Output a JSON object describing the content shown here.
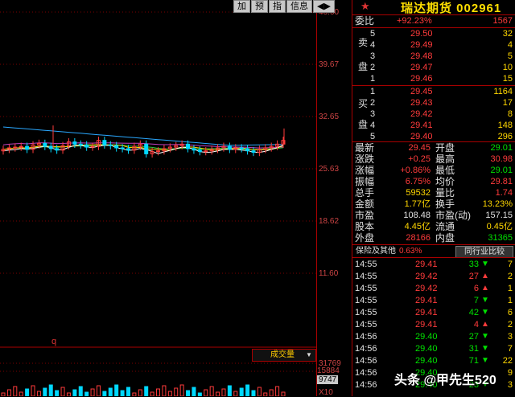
{
  "toolbar": [
    "加",
    "预",
    "指",
    "信息",
    "◀▶"
  ],
  "price_axis": [
    "46.60",
    "39.67",
    "32.65",
    "25.63",
    "18.62",
    "11.60"
  ],
  "volume_axis": [
    "31769",
    "15884",
    "9747",
    "X10"
  ],
  "volume_button": "成交量",
  "volume_button_arrow": "▼",
  "marker_q": "q",
  "chart_data": {
    "type": "candlestick",
    "title": "",
    "ylim": [
      11.6,
      46.6
    ],
    "closes": [
      28.2,
      28.4,
      28.5,
      28.6,
      28.2,
      28.8,
      29.0,
      28.6,
      28.3,
      28.1,
      28.7,
      29.2,
      28.9,
      28.8,
      28.5,
      28.6,
      29.4,
      28.8,
      28.7,
      28.4,
      28.3,
      28.1,
      28.6,
      28.9,
      27.6,
      27.9,
      28.0,
      28.3,
      28.5,
      28.7,
      28.9,
      28.3,
      28.1,
      27.9,
      28.0,
      28.2,
      28.4,
      28.6,
      28.2,
      28.4,
      28.3,
      28.0,
      27.8,
      28.2,
      28.4,
      28.6,
      28.9,
      29.4
    ]
  },
  "panel": {
    "title_star": "★",
    "title": "瑞达期货 002961",
    "weibi_label": "委比",
    "weibi_pct": "+92.23%",
    "weibi_val": "1567",
    "sell_side": [
      "卖",
      "盘"
    ],
    "buy_side": [
      "买",
      "盘"
    ],
    "sell": [
      {
        "n": "5",
        "p": "29.50",
        "v": "32"
      },
      {
        "n": "4",
        "p": "29.49",
        "v": "4"
      },
      {
        "n": "3",
        "p": "29.48",
        "v": "5"
      },
      {
        "n": "2",
        "p": "29.47",
        "v": "10"
      },
      {
        "n": "1",
        "p": "29.46",
        "v": "15"
      }
    ],
    "buy": [
      {
        "n": "1",
        "p": "29.45",
        "v": "1164"
      },
      {
        "n": "2",
        "p": "29.43",
        "v": "17"
      },
      {
        "n": "3",
        "p": "29.42",
        "v": "8"
      },
      {
        "n": "4",
        "p": "29.41",
        "v": "148"
      },
      {
        "n": "5",
        "p": "29.40",
        "v": "296"
      }
    ],
    "stats": [
      {
        "l1": "最新",
        "v1": "29.45",
        "c1": "red",
        "l2": "开盘",
        "v2": "29.01",
        "c2": "green"
      },
      {
        "l1": "涨跌",
        "v1": "+0.25",
        "c1": "red",
        "l2": "最高",
        "v2": "30.98",
        "c2": "red"
      },
      {
        "l1": "涨幅",
        "v1": "+0.86%",
        "c1": "red",
        "l2": "最低",
        "v2": "29.01",
        "c2": "green"
      },
      {
        "l1": "振幅",
        "v1": "6.75%",
        "c1": "red",
        "l2": "均价",
        "v2": "29.81",
        "c2": "red"
      },
      {
        "l1": "总手",
        "v1": "59532",
        "c1": "yellow",
        "l2": "量比",
        "v2": "1.74",
        "c2": "red"
      },
      {
        "l1": "金额",
        "v1": "1.77亿",
        "c1": "yellow",
        "l2": "换手",
        "v2": "13.23%",
        "c2": "yellow"
      },
      {
        "l1": "市盈",
        "v1": "108.48",
        "c1": "white",
        "l2": "市盈(动)",
        "v2": "157.15",
        "c2": "white"
      },
      {
        "l1": "股本",
        "v1": "4.45亿",
        "c1": "yellow",
        "l2": "流通",
        "v2": "0.45亿",
        "c2": "yellow"
      },
      {
        "l1": "外盘",
        "v1": "28166",
        "c1": "red",
        "l2": "内盘",
        "v2": "31365",
        "c2": "green"
      }
    ],
    "tab1": "保险及其他",
    "tab1_pct": "0.63%",
    "tab2": "同行业比较",
    "ticks": [
      {
        "t": "14:55",
        "p": "29.41",
        "pc": "red",
        "v": "33",
        "d": "down",
        "n": "7"
      },
      {
        "t": "14:55",
        "p": "29.42",
        "pc": "red",
        "v": "27",
        "d": "up",
        "n": "2"
      },
      {
        "t": "14:55",
        "p": "29.42",
        "pc": "red",
        "v": "6",
        "d": "up",
        "n": "1"
      },
      {
        "t": "14:55",
        "p": "29.41",
        "pc": "red",
        "v": "7",
        "d": "down",
        "n": "1"
      },
      {
        "t": "14:55",
        "p": "29.41",
        "pc": "red",
        "v": "42",
        "d": "down",
        "n": "6"
      },
      {
        "t": "14:55",
        "p": "29.41",
        "pc": "red",
        "v": "4",
        "d": "up",
        "n": "2"
      },
      {
        "t": "14:56",
        "p": "29.40",
        "pc": "green",
        "v": "27",
        "d": "down",
        "n": "3"
      },
      {
        "t": "14:56",
        "p": "29.40",
        "pc": "green",
        "v": "31",
        "d": "down",
        "n": "7"
      },
      {
        "t": "14:56",
        "p": "29.40",
        "pc": "green",
        "v": "71",
        "d": "down",
        "n": "22"
      },
      {
        "t": "14:56",
        "p": "29.40",
        "pc": "green",
        "v": "",
        "d": "",
        "n": "9"
      },
      {
        "t": "14:56",
        "p": "29.40",
        "pc": "green",
        "v": "23",
        "d": "down",
        "n": "3"
      }
    ]
  },
  "watermark": "头条 @甲先生520"
}
